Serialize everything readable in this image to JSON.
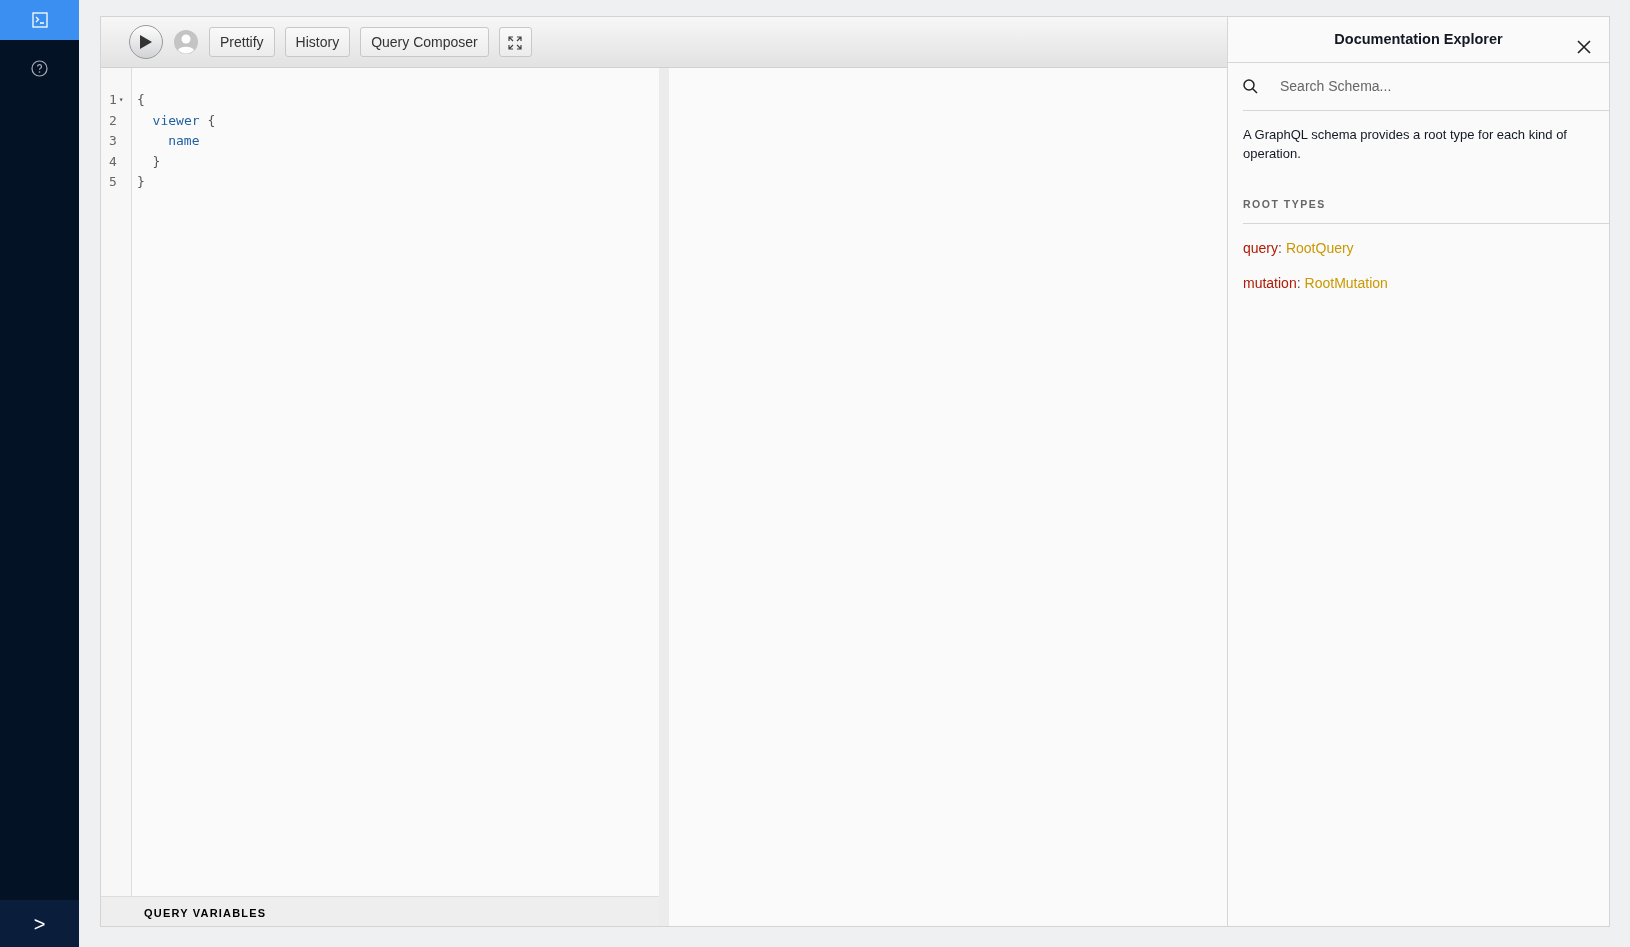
{
  "sidebar": {
    "items": [
      {
        "kind": "console",
        "selected": true
      },
      {
        "kind": "help",
        "selected": false
      }
    ],
    "expand_glyph": ">"
  },
  "toolbar": {
    "buttons": [
      "Prettify",
      "History",
      "Query Composer"
    ]
  },
  "editor": {
    "lines": [
      {
        "number": "1",
        "fold": "▾",
        "tokens": [
          {
            "text": "{",
            "kind": "punct"
          }
        ]
      },
      {
        "number": "2",
        "tokens": [
          {
            "text": "viewer",
            "kind": "field"
          },
          {
            "text": "{",
            "kind": "punct"
          }
        ]
      },
      {
        "number": "3",
        "tokens": [
          {
            "text": "name",
            "kind": "field"
          }
        ]
      },
      {
        "number": "4",
        "tokens": [
          {
            "text": "}",
            "kind": "punct"
          }
        ]
      },
      {
        "number": "5",
        "tokens": [
          {
            "text": "}",
            "kind": "punct"
          }
        ]
      }
    ],
    "variables_title": "QUERY VARIABLES"
  },
  "docs": {
    "title": "Documentation Explorer",
    "search": {
      "placeholder": "Search Schema..."
    },
    "description": "A GraphQL schema provides a root type for each kind of operation.",
    "section_title": "ROOT TYPES",
    "root_types": [
      {
        "name": "query",
        "separator": ":",
        "type": "RootQuery"
      },
      {
        "name": "mutation",
        "separator": ":",
        "type": "RootMutation"
      }
    ]
  }
}
